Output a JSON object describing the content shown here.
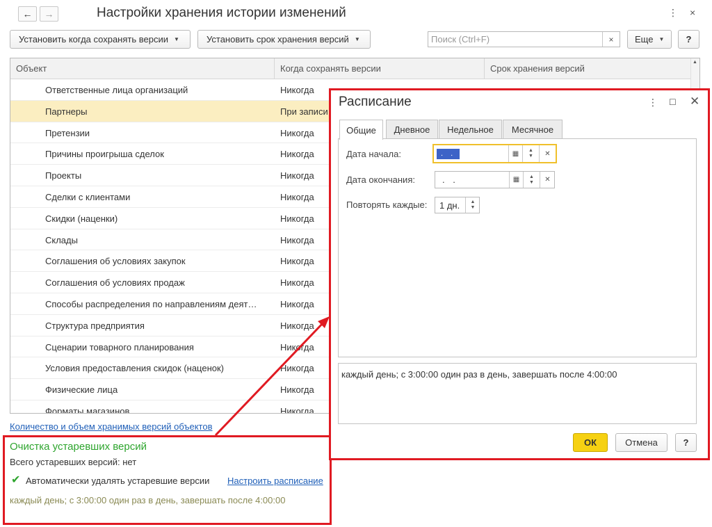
{
  "header": {
    "title": "Настройки хранения истории изменений",
    "back_icon": "arrow-left",
    "forward_icon": "arrow-right",
    "more_glyph": "⋮",
    "close_glyph": "×"
  },
  "toolbar": {
    "when_save_label": "Установить когда сохранять версии",
    "retention_label": "Установить срок хранения версий",
    "search_placeholder": "Поиск (Ctrl+F)",
    "search_clear": "×",
    "more_label": "Еще",
    "help_label": "?"
  },
  "table": {
    "columns": [
      "Объект",
      "Когда сохранять версии",
      "Срок хранения версий"
    ],
    "rows": [
      {
        "object": "Ответственные лица организаций",
        "when": "Никогда"
      },
      {
        "object": "Партнеры",
        "when": "При записи",
        "selected": true
      },
      {
        "object": "Претензии",
        "when": "Никогда"
      },
      {
        "object": "Причины проигрыша сделок",
        "when": "Никогда"
      },
      {
        "object": "Проекты",
        "when": "Никогда"
      },
      {
        "object": "Сделки с клиентами",
        "when": "Никогда"
      },
      {
        "object": "Скидки (наценки)",
        "when": "Никогда"
      },
      {
        "object": "Склады",
        "when": "Никогда"
      },
      {
        "object": "Соглашения об условиях закупок",
        "when": "Никогда"
      },
      {
        "object": "Соглашения об условиях продаж",
        "when": "Никогда"
      },
      {
        "object": "Способы распределения по направлениям деят…",
        "when": "Никогда"
      },
      {
        "object": "Структура предприятия",
        "when": "Никогда"
      },
      {
        "object": "Сценарии товарного планирования",
        "when": "Никогда"
      },
      {
        "object": "Условия предоставления скидок (наценок)",
        "when": "Никогда"
      },
      {
        "object": "Физические лица",
        "when": "Никогда"
      },
      {
        "object": "Форматы магазинов",
        "when": "Никогда"
      }
    ]
  },
  "footer": {
    "versions_link": "Количество и объем хранимых версий объектов",
    "cleanup_title": "Очистка устаревших версий",
    "total_outdated": "Всего устаревших версий: нет",
    "auto_delete_label": "Автоматически удалять устаревшие версии",
    "auto_delete_checked": true,
    "schedule_link": "Настроить расписание",
    "schedule_text": "каждый день; с 3:00:00 один раз в день, завершать после 4:00:00"
  },
  "dialog": {
    "title": "Расписание",
    "tabs": [
      "Общие",
      "Дневное",
      "Недельное",
      "Месячное"
    ],
    "active_tab": 0,
    "start_label": "Дата начала:",
    "start_value": ". .",
    "end_label": "Дата окончания:",
    "end_value": ". .",
    "repeat_label": "Повторять каждые:",
    "repeat_value": "1 дн.",
    "description": "каждый день; с 3:00:00 один раз в день, завершать после 4:00:00",
    "ok_label": "ОК",
    "cancel_label": "Отмена",
    "help_label": "?"
  },
  "colors": {
    "annotation_red": "#e01a22",
    "selected_row": "#fbeec1",
    "ok_yellow": "#f6d112",
    "link_blue": "#1f5fb8",
    "heading_green": "#2ea52e"
  }
}
